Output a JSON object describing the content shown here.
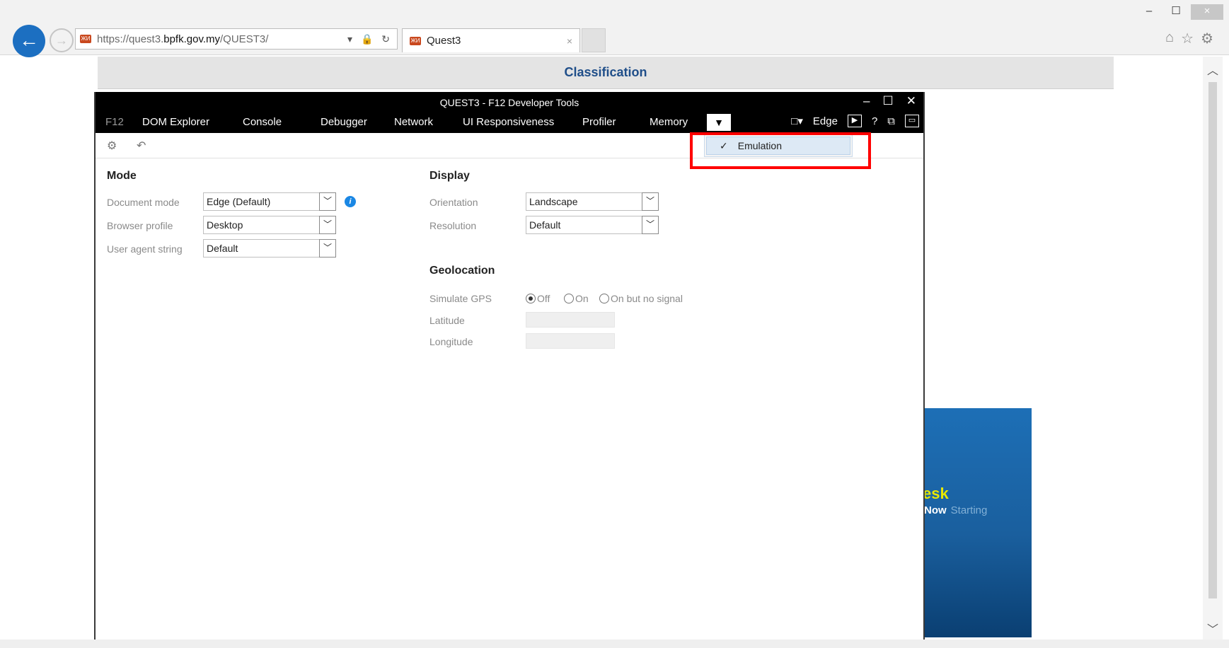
{
  "browser": {
    "url_scheme": "https://",
    "url_host_prefix": "quest3.",
    "url_host_main": "bpfk.gov.my",
    "url_path": "/QUEST3/",
    "tab_title": "Quest3",
    "tab_close": "×",
    "address_controls": "▾ 🔒 ↻",
    "window_buttons": [
      "–",
      "☐",
      "×"
    ],
    "chrome_icons": [
      "⌂",
      "☆",
      "⚙"
    ],
    "back_glyph": "←",
    "forward_glyph": "→",
    "favicon": "ЖИ"
  },
  "page": {
    "title": "Classification",
    "banner_word": "esk",
    "banner_now": "Now",
    "banner_starting": "Starting"
  },
  "devtools": {
    "title": "QUEST3 - F12 Developer Tools",
    "window_buttons": [
      "–",
      "☐",
      "✕"
    ],
    "tabs": [
      "F12",
      "DOM Explorer",
      "Console",
      "Debugger",
      "Network",
      "UI Responsiveness",
      "Profiler",
      "Memory"
    ],
    "more_tools_glyph": "▼",
    "target_label": "Edge",
    "right_icons": {
      "screen": "□▾",
      "console": "▶",
      "help": "?",
      "undock": "⧉",
      "dock": "▭"
    },
    "menu": {
      "check": "✓",
      "item": "Emulation"
    },
    "mode": {
      "heading": "Mode",
      "document_mode_label": "Document mode",
      "document_mode_value": "Edge (Default)",
      "browser_profile_label": "Browser profile",
      "browser_profile_value": "Desktop",
      "user_agent_label": "User agent string",
      "user_agent_value": "Default"
    },
    "display": {
      "heading": "Display",
      "orientation_label": "Orientation",
      "orientation_value": "Landscape",
      "resolution_label": "Resolution",
      "resolution_value": "Default"
    },
    "geolocation": {
      "heading": "Geolocation",
      "simulate_gps_label": "Simulate GPS",
      "options": [
        "Off",
        "On",
        "On but no signal"
      ],
      "selected": "Off",
      "latitude_label": "Latitude",
      "longitude_label": "Longitude"
    }
  }
}
